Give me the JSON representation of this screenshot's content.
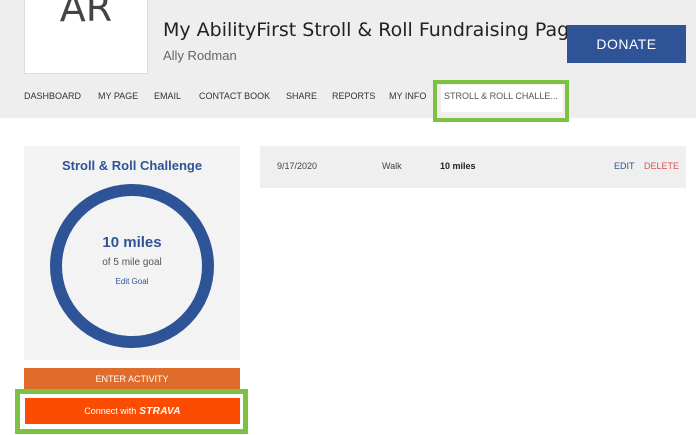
{
  "header": {
    "avatar_initials": "AR",
    "title": "My AbilityFirst Stroll & Roll Fundraising Page",
    "owner": "Ally Rodman",
    "donate_label": "DONATE"
  },
  "nav": {
    "items": [
      {
        "label": "DASHBOARD"
      },
      {
        "label": "MY PAGE"
      },
      {
        "label": "EMAIL"
      },
      {
        "label": "CONTACT BOOK"
      },
      {
        "label": "SHARE"
      },
      {
        "label": "REPORTS"
      },
      {
        "label": "MY INFO"
      },
      {
        "label": "STROLL & ROLL CHALLE..."
      }
    ],
    "active_index": 7
  },
  "challenge": {
    "title": "Stroll & Roll Challenge",
    "progress_value": "10 miles",
    "goal_text": "of 5 mile goal",
    "edit_goal_label": "Edit Goal",
    "enter_activity_label": "ENTER ACTIVITY",
    "connect_label": "Connect with",
    "strava_label": "STRAVA"
  },
  "activities": [
    {
      "date": "9/17/2020",
      "type": "Walk",
      "distance": "10 miles",
      "edit_label": "EDIT",
      "delete_label": "DELETE"
    }
  ],
  "colors": {
    "brand_blue": "#2e5497",
    "highlight_green": "#7cc242",
    "enter_orange": "#e06c2b",
    "strava_orange": "#fc4c02",
    "delete_red": "#d9534f"
  }
}
